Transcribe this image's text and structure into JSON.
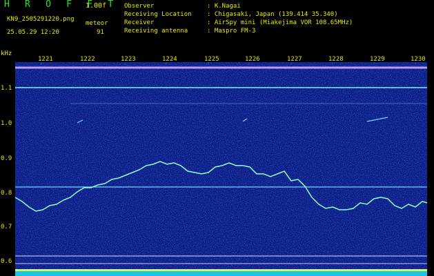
{
  "header": {
    "title": "H R O F F T",
    "version": "1.00f",
    "filename": "KN9_2505291220.png",
    "meteor_label": "meteor",
    "datetime": "25.05.29 12:20",
    "meteor_count": "91",
    "info": [
      {
        "key": "Observer",
        "value": ": K.Nagai"
      },
      {
        "key": "Receiving Location",
        "value": ": Chigasaki, Japan (139.414 35.340)"
      },
      {
        "key": "Receiver",
        "value": ": AirSpy mini (Miakejima VOR 108.65MHz)"
      },
      {
        "key": "Receiving antenna",
        "value": ": Maspro FM-3"
      }
    ]
  },
  "axes": {
    "y_unit": "kHz",
    "y_ticks": [
      "1.1",
      "1.0",
      "0.9",
      "0.8",
      "0.7",
      "0.6"
    ],
    "x_ticks": [
      "1221",
      "1222",
      "1223",
      "1224",
      "1225",
      "1226",
      "1227",
      "1228",
      "1229",
      "1230"
    ]
  },
  "colors": {
    "background": "#0a1a86",
    "trace": "#8fffd0",
    "label": "#e8e800",
    "title": "#2fe02f"
  }
}
